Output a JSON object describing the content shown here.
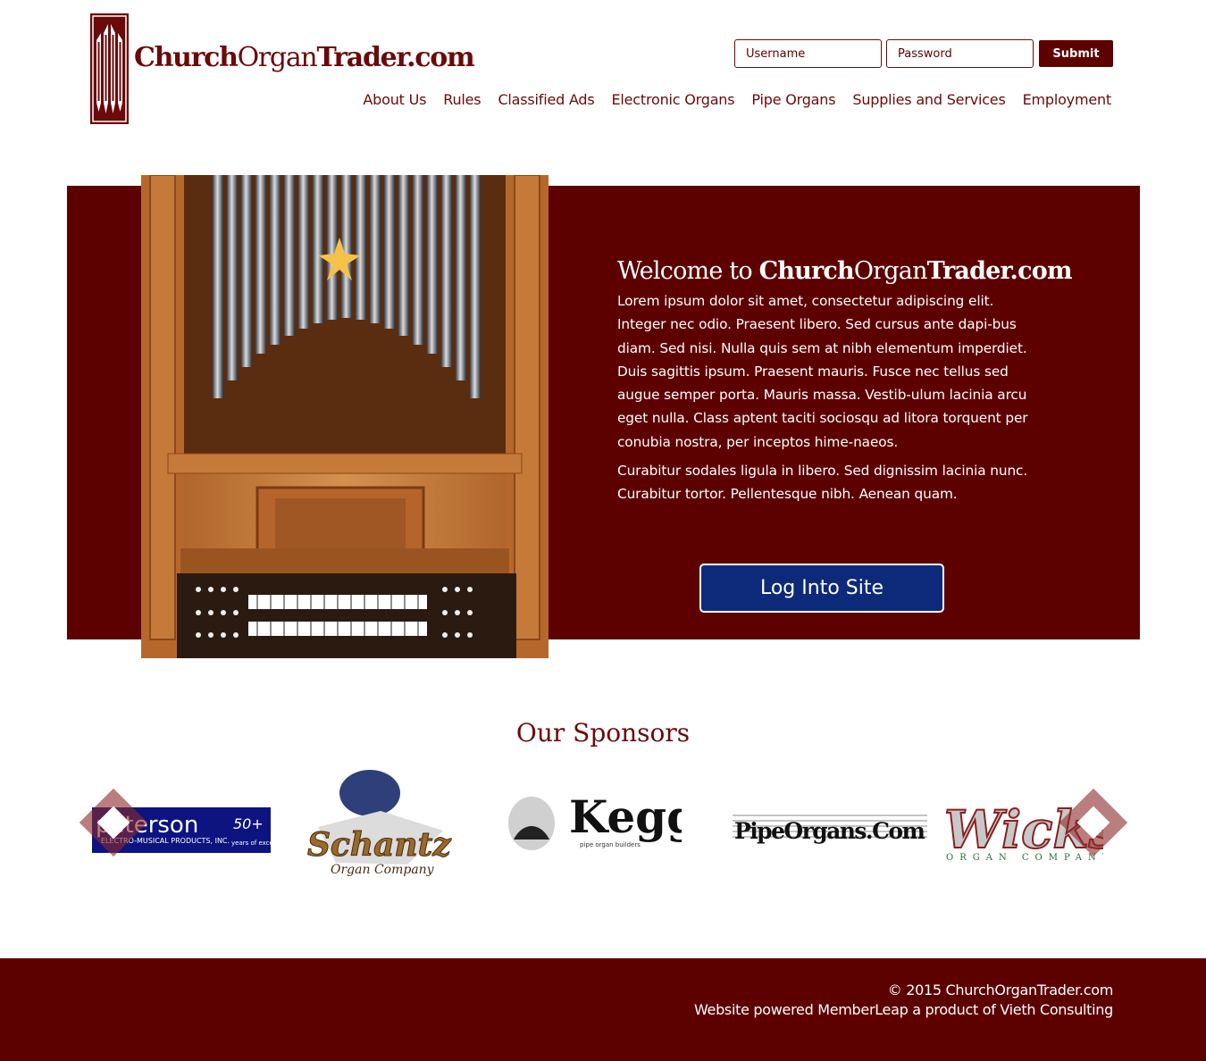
{
  "header": {
    "logo": {
      "bold_1": "Church",
      "light": "Organ",
      "bold_2": "Trader.com"
    },
    "login": {
      "username_placeholder": "Username",
      "password_placeholder": "Password",
      "submit_label": "Submit"
    },
    "nav": [
      {
        "label": "About Us"
      },
      {
        "label": "Rules"
      },
      {
        "label": "Classified Ads"
      },
      {
        "label": "Electronic Organs"
      },
      {
        "label": "Pipe Organs"
      },
      {
        "label": "Supplies and Services"
      },
      {
        "label": "Employment"
      }
    ]
  },
  "hero": {
    "welcome_prefix": "Welcome to ",
    "brand_bold_1": "Church",
    "brand_light": "Organ",
    "brand_bold_2": "Trader.com",
    "paragraph_1": "Lorem ipsum dolor sit amet, consectetur adipiscing elit. Integer nec odio. Praesent libero. Sed cursus ante dapi-bus diam. Sed nisi. Nulla quis sem at nibh elementum imperdiet. Duis sagittis ipsum. Praesent mauris. Fusce nec tellus sed augue semper porta. Mauris massa. Vestib-ulum lacinia arcu eget nulla. Class aptent taciti sociosqu ad litora torquent per conubia nostra, per inceptos hime-naeos.",
    "paragraph_2": "Curabitur sodales ligula in libero. Sed dignissim lacinia nunc. Curabitur tortor. Pellentesque nibh. Aenean quam.",
    "button_label": "Log Into Site"
  },
  "sponsors": {
    "title": "Our Sponsors",
    "items": [
      {
        "name": "peterson",
        "plus": "50+",
        "sub": "ELECTRO-MUSICAL PRODUCTS, INC.",
        "tag": "years of excellence"
      },
      {
        "name": "Schantz",
        "sub": "Organ Company"
      },
      {
        "name": "Kegg",
        "sub": "pipe organ builders"
      },
      {
        "name": "PipeOrgans.Com"
      },
      {
        "name": "Wicks",
        "sub": "ORGAN COMPANY"
      }
    ]
  },
  "footer": {
    "copyright": "© 2015 ChurchOrganTrader.com",
    "powered": "Website powered MemberLeap a product of Vieth Consulting"
  },
  "colors": {
    "brand": "#5d0000",
    "button_blue": "#0d2a7a"
  }
}
